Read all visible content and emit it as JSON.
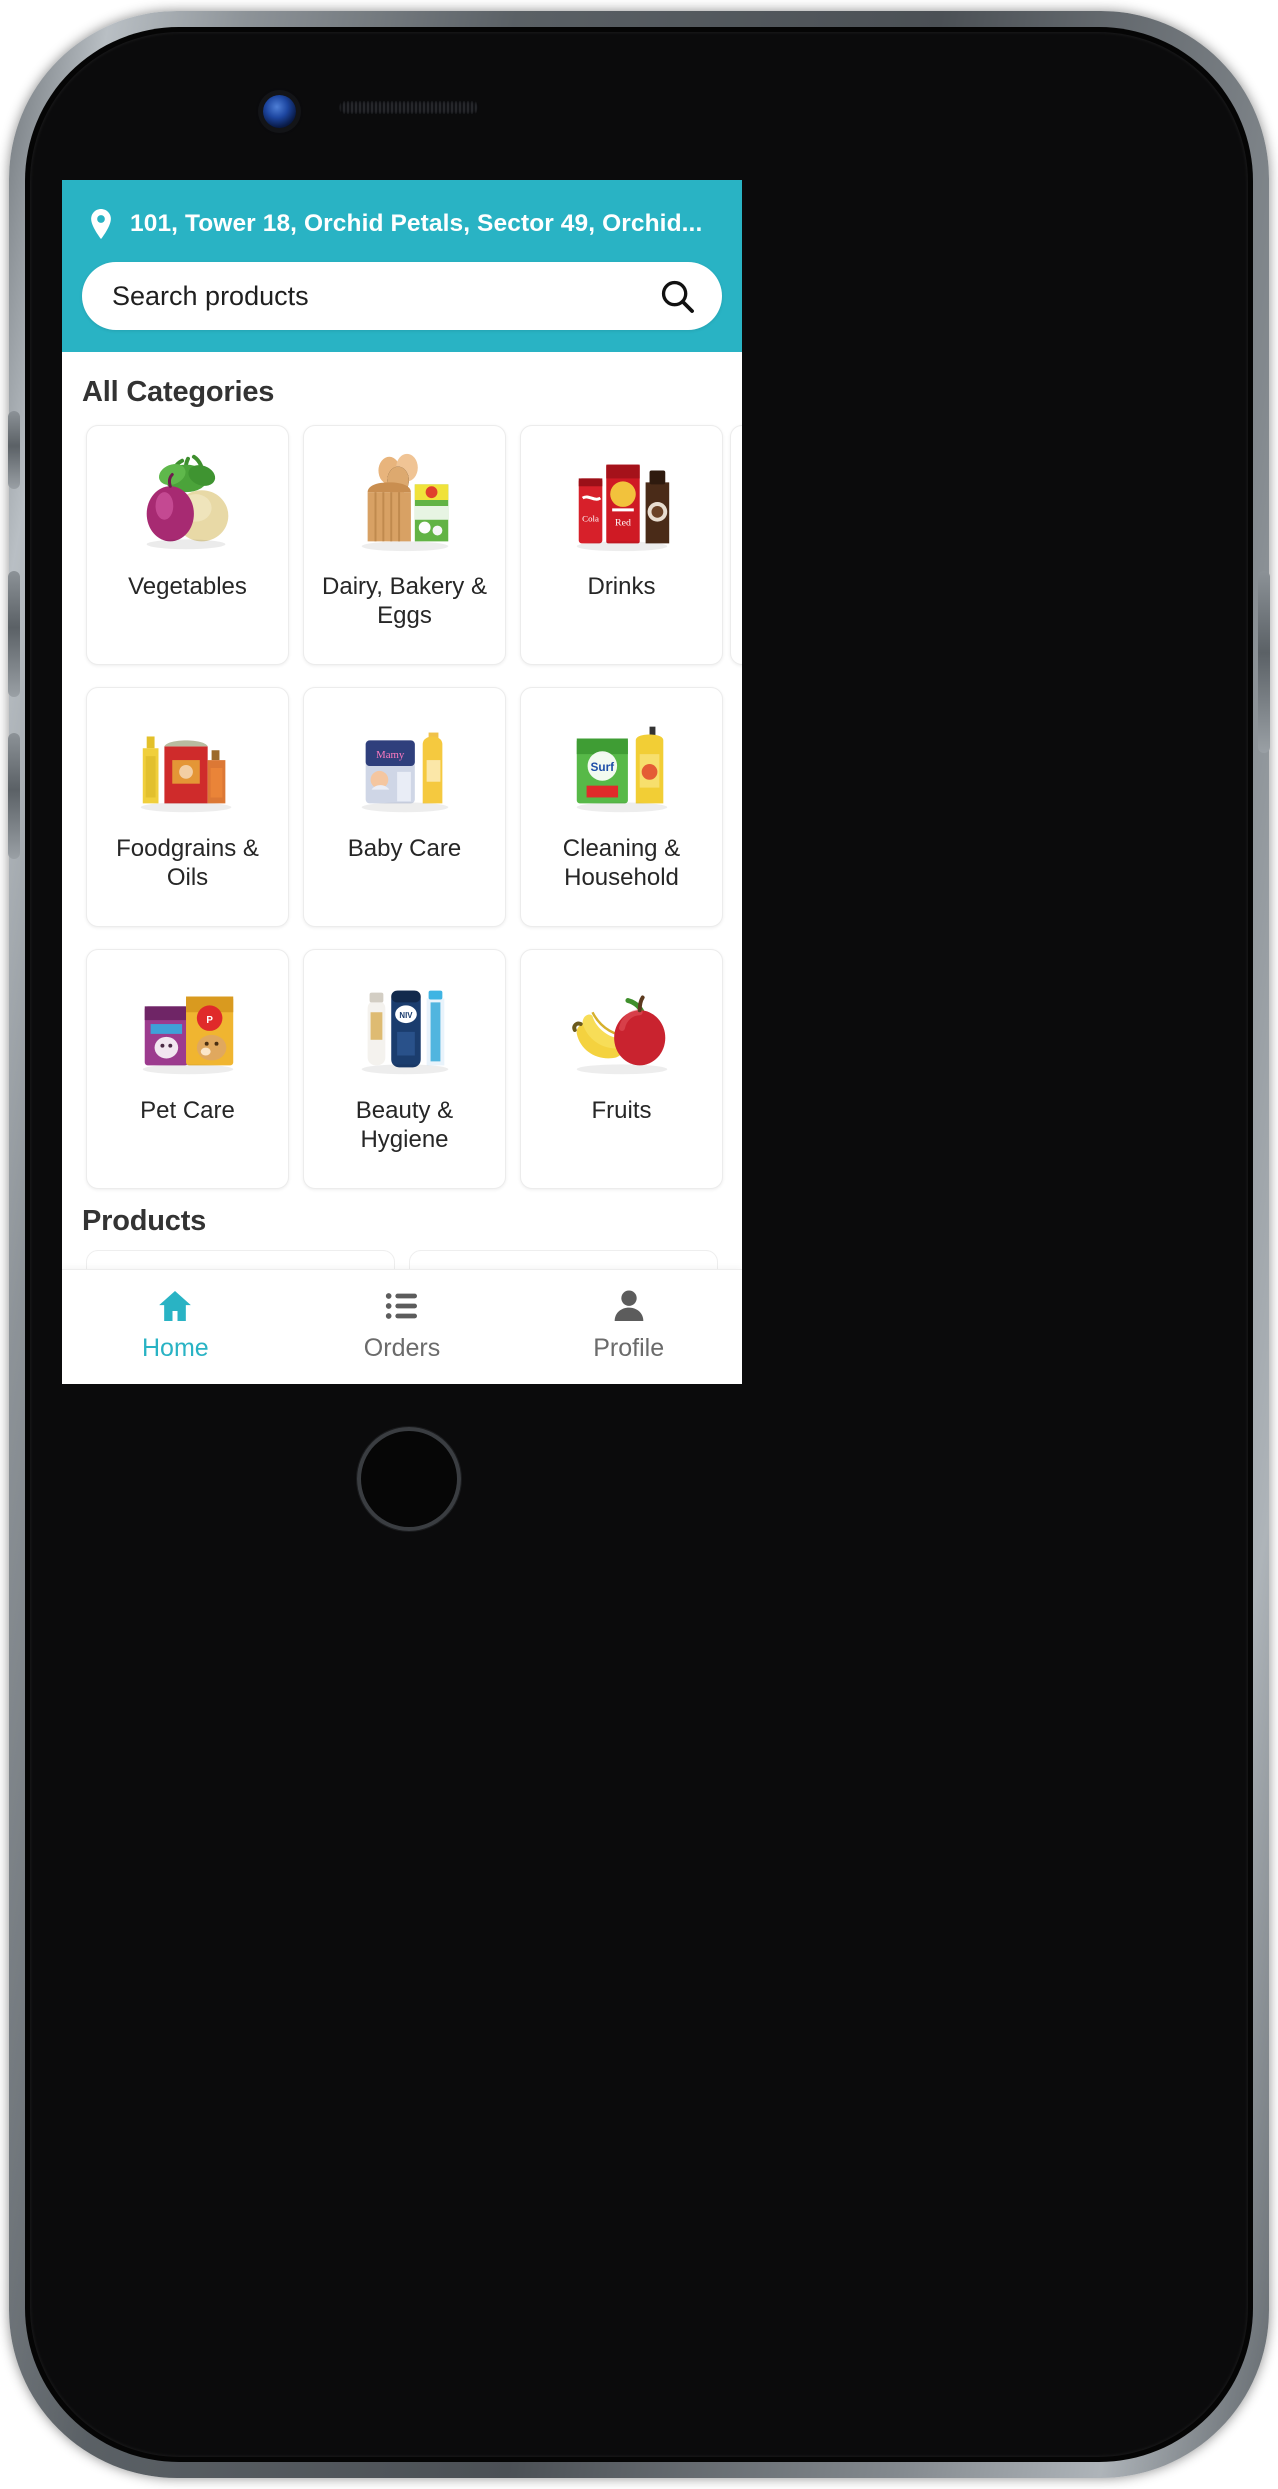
{
  "device": {
    "camera_icon": "front-camera",
    "speaker_icon": "earpiece-speaker",
    "home_button_icon": "home-button"
  },
  "header": {
    "background_color": "#29b3c4",
    "location_icon": "location-pin-icon",
    "address": "101, Tower 18, Orchid Petals, Sector 49, Orchid...",
    "search": {
      "placeholder": "Search products",
      "value": "",
      "icon": "search-icon"
    }
  },
  "categories_section": {
    "title": "All Categories",
    "items": [
      {
        "label": "Vegetables",
        "image": "vegetables-image"
      },
      {
        "label": "Dairy, Bakery & Eggs",
        "image": "dairy-bakery-eggs-image"
      },
      {
        "label": "Drinks",
        "image": "drinks-image"
      },
      {
        "label": "Foodgrains & Oils",
        "image": "foodgrains-oils-image"
      },
      {
        "label": "Baby Care",
        "image": "baby-care-image"
      },
      {
        "label": "Cleaning & Household",
        "image": "cleaning-household-image"
      },
      {
        "label": "Pet Care",
        "image": "pet-care-image"
      },
      {
        "label": "Beauty & Hygiene",
        "image": "beauty-hygiene-image"
      },
      {
        "label": "Fruits",
        "image": "fruits-image"
      }
    ]
  },
  "products_section": {
    "title": "Products"
  },
  "bottom_nav": {
    "active_color": "#29b3c4",
    "inactive_color": "#6b6b6b",
    "items": [
      {
        "label": "Home",
        "icon": "home-icon",
        "active": true
      },
      {
        "label": "Orders",
        "icon": "list-icon",
        "active": false
      },
      {
        "label": "Profile",
        "icon": "person-icon",
        "active": false
      }
    ]
  }
}
